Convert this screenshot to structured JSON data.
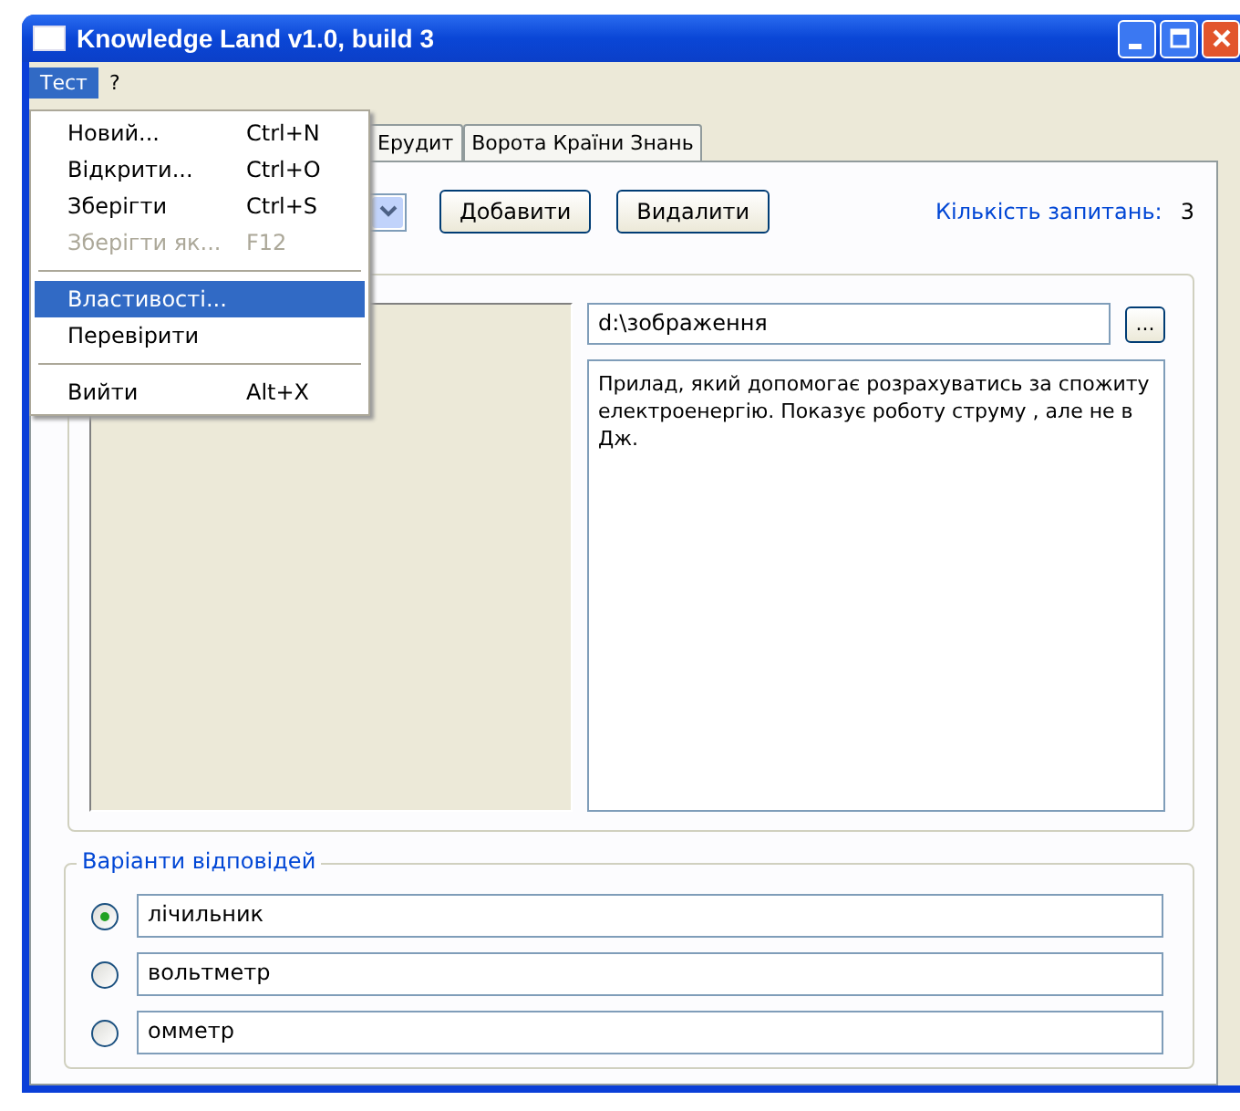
{
  "window": {
    "title": "Knowledge Land v1.0, build 3"
  },
  "menu_bar": [
    {
      "label": "Тест",
      "selected": true
    },
    {
      "label": "?",
      "selected": false
    }
  ],
  "menu": [
    {
      "kind": "item",
      "label": "Новий...",
      "shortcut": "Ctrl+N",
      "disabled": false,
      "selected": false
    },
    {
      "kind": "item",
      "label": "Відкрити...",
      "shortcut": "Ctrl+O",
      "disabled": false,
      "selected": false
    },
    {
      "kind": "item",
      "label": "Зберігти",
      "shortcut": "Ctrl+S",
      "disabled": false,
      "selected": false
    },
    {
      "kind": "item",
      "label": "Зберігти як...",
      "shortcut": "F12",
      "disabled": true,
      "selected": false
    },
    {
      "kind": "separator"
    },
    {
      "kind": "item",
      "label": "Властивості...",
      "disabled": false,
      "selected": true
    },
    {
      "kind": "item",
      "label": "Перевірити",
      "disabled": false,
      "selected": false
    },
    {
      "kind": "separator"
    },
    {
      "kind": "item",
      "label": "Вийти",
      "shortcut": "Alt+X",
      "disabled": false,
      "selected": false
    }
  ],
  "tabs": [
    {
      "label": "Ерудит",
      "selected": false
    },
    {
      "label": "Ворота Країни Знань",
      "selected": false
    }
  ],
  "toolbar": {
    "buttons": [
      "Добавити",
      "Видалити"
    ],
    "count_label": "Кількість запитань:",
    "count_value": "3"
  },
  "question": {
    "image_path": "d:\\зображення",
    "browse_button": "...",
    "text": "Прилад, який допомогає розрахуватись за спожиту електроенергію. Показує роботу струму , але не в Дж."
  },
  "answers": {
    "legend": "Варіанти відповідей",
    "options": [
      {
        "value": "лічильник",
        "selected": true
      },
      {
        "value": "вольтметр",
        "selected": false
      },
      {
        "value": "омметр",
        "selected": false
      }
    ]
  }
}
